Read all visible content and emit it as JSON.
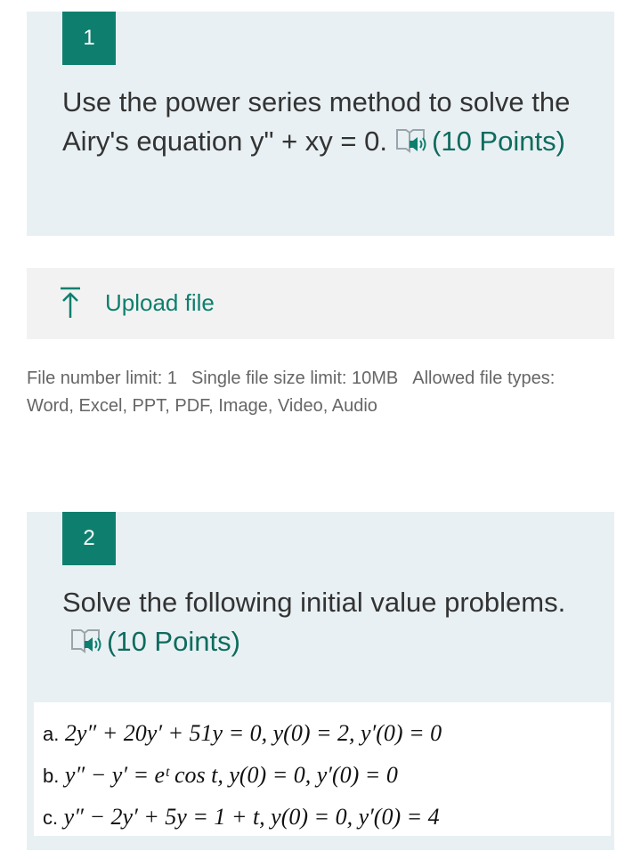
{
  "question1": {
    "number": "1",
    "text": "Use the power series method to solve the Airy's equation y\" + xy = 0.",
    "points": "(10 Points)"
  },
  "upload": {
    "label": "Upload file",
    "icon": "upload-icon"
  },
  "limits": {
    "file_number": "File number limit: 1",
    "file_size": "Single file size limit: 10MB",
    "file_types_label": "Allowed file types:",
    "file_types": "Word, Excel, PPT, PDF, Image, Video, Audio"
  },
  "question2": {
    "number": "2",
    "text": "Solve the following initial value problems.",
    "points": "(10 Points)",
    "problems": [
      {
        "letter": "a.",
        "equation": "2y″ + 20y′ + 51y = 0,   y(0) = 2,   y′(0) = 0"
      },
      {
        "letter": "b.",
        "equation": "y″ − y′ = eᵗ cos t,   y(0) = 0,   y′(0) = 0"
      },
      {
        "letter": "c.",
        "equation": "y″ − 2y′ + 5y = 1 + t,   y(0) = 0,   y′(0) = 4"
      }
    ]
  },
  "colors": {
    "accent": "#0e7f6e",
    "card_bg": "#e8f0f3",
    "upload_bg": "#f2f2f2"
  }
}
